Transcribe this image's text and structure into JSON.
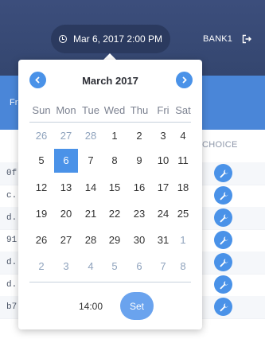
{
  "header": {
    "datetime_label": "Mar 6, 2017 2:00 PM",
    "bank_label": "BANK1"
  },
  "band": {
    "left_text": "Fr"
  },
  "table": {
    "choice_header": "CHOICE",
    "rows": [
      {
        "text": "0f..."
      },
      {
        "text": "c..."
      },
      {
        "text": "d..."
      },
      {
        "text": "91..."
      },
      {
        "text": "d..."
      },
      {
        "text": "d..."
      },
      {
        "text": "b7..."
      }
    ]
  },
  "calendar": {
    "month_title": "March 2017",
    "weekdays": [
      "Sun",
      "Mon",
      "Tue",
      "Wed",
      "Thu",
      "Fri",
      "Sat"
    ],
    "weeks": [
      [
        {
          "d": "26",
          "o": true
        },
        {
          "d": "27",
          "o": true
        },
        {
          "d": "28",
          "o": true
        },
        {
          "d": "1"
        },
        {
          "d": "2"
        },
        {
          "d": "3"
        },
        {
          "d": "4"
        }
      ],
      [
        {
          "d": "5"
        },
        {
          "d": "6",
          "sel": true
        },
        {
          "d": "7"
        },
        {
          "d": "8"
        },
        {
          "d": "9"
        },
        {
          "d": "10"
        },
        {
          "d": "11"
        }
      ],
      [
        {
          "d": "12"
        },
        {
          "d": "13"
        },
        {
          "d": "14"
        },
        {
          "d": "15"
        },
        {
          "d": "16"
        },
        {
          "d": "17"
        },
        {
          "d": "18"
        }
      ],
      [
        {
          "d": "19"
        },
        {
          "d": "20"
        },
        {
          "d": "21"
        },
        {
          "d": "22"
        },
        {
          "d": "23"
        },
        {
          "d": "24"
        },
        {
          "d": "25"
        }
      ],
      [
        {
          "d": "26"
        },
        {
          "d": "27"
        },
        {
          "d": "28"
        },
        {
          "d": "29"
        },
        {
          "d": "30"
        },
        {
          "d": "31"
        },
        {
          "d": "1",
          "o": true
        }
      ],
      [
        {
          "d": "2",
          "o": true
        },
        {
          "d": "3",
          "o": true
        },
        {
          "d": "4",
          "o": true
        },
        {
          "d": "5",
          "o": true
        },
        {
          "d": "6",
          "o": true
        },
        {
          "d": "7",
          "o": true
        },
        {
          "d": "8",
          "o": true
        }
      ]
    ],
    "time_value": "14:00",
    "set_label": "Set"
  },
  "icons": {
    "clock": "clock-icon",
    "logout": "logout-icon",
    "prev": "chevron-left-icon",
    "next": "chevron-right-icon",
    "wrench": "wrench-icon"
  },
  "colors": {
    "header_bg": "#3c4e7c",
    "accent_blue": "#4a92e8",
    "band_blue": "#4a86d8",
    "set_button": "#6aa3ee"
  }
}
